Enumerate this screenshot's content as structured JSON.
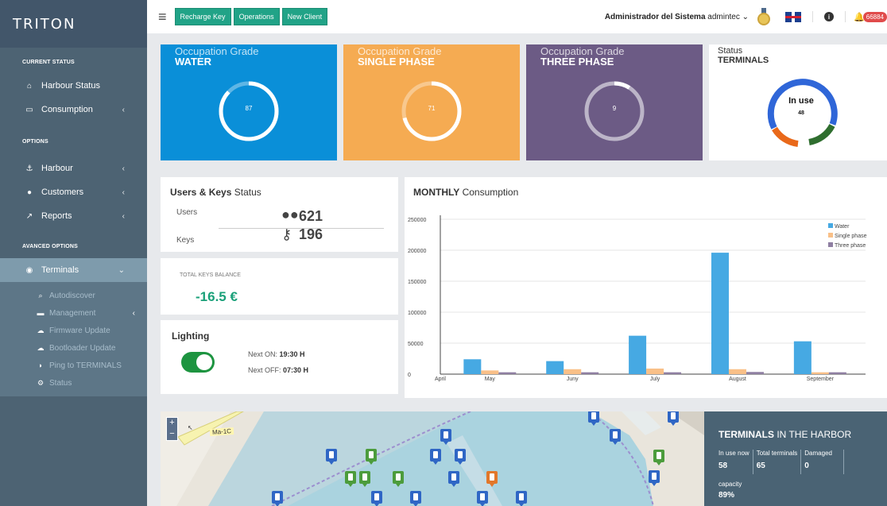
{
  "brand": "TRITON",
  "sidebar": {
    "sections": {
      "current": "CURRENT STATUS",
      "options": "OPTIONS",
      "advanced": "AVANCED OPTIONS"
    },
    "items": {
      "harbour_status": "Harbour Status",
      "consumption": "Consumption",
      "harbour": "Harbour",
      "customers": "Customers",
      "reports": "Reports",
      "terminals": "Terminals"
    },
    "submenu": {
      "autodiscover": "Autodiscover",
      "management": "Management",
      "firmware": "Firmware Update",
      "bootloader": "Bootloader Update",
      "ping": "Ping to TERMINALS",
      "status": "Status"
    }
  },
  "topbar": {
    "buttons": [
      "Recharge Key",
      "Operations",
      "New Client"
    ],
    "admin_name": "Administrador del Sistema",
    "admin_user": "admintec",
    "notifications": "66884"
  },
  "tiles": {
    "water": {
      "label": "Occupation Grade",
      "name": "WATER",
      "value": "87",
      "color": "#0a8fd8"
    },
    "single": {
      "label": "Occupation Grade",
      "name": "SINGLE PHASE",
      "value": "71",
      "color": "#f5ab52"
    },
    "three": {
      "label": "Occupation Grade",
      "name": "THREE PHASE",
      "value": "9",
      "color": "#6c5b85"
    }
  },
  "status_tile": {
    "label": "Status",
    "name": "TERMINALS",
    "center_label": "In use",
    "center_value": "48"
  },
  "users_keys": {
    "title_bold": "Users & Keys",
    "title_rest": " Status",
    "users_label": "Users",
    "users_value": "621",
    "keys_label": "Keys",
    "keys_value": "196"
  },
  "balance": {
    "label": "TOTAL KEYS BALANCE",
    "value": "-16.5 €"
  },
  "lighting": {
    "title": "Lighting",
    "next_on_label": "Next ON:",
    "next_on": "19:30 H",
    "next_off_label": "Next OFF:",
    "next_off": "07:30 H",
    "enabled": true
  },
  "monthly": {
    "title_bold": "MONTHLY",
    "title_rest": " Consumption"
  },
  "chart_data": {
    "type": "bar",
    "title": "MONTHLY Consumption",
    "categories": [
      "May",
      "Juny",
      "July",
      "August",
      "September"
    ],
    "x_start_label": "April",
    "series": [
      {
        "name": "Water",
        "color": "#46a9e3",
        "values": [
          24000,
          21000,
          62000,
          196000,
          53000
        ]
      },
      {
        "name": "Single phase",
        "color": "#f9c088",
        "values": [
          6000,
          8000,
          9000,
          8000,
          3000
        ]
      },
      {
        "name": "Three phase",
        "color": "#8f7fa2",
        "values": [
          3000,
          3000,
          3000,
          3500,
          3000
        ]
      }
    ],
    "ylim": [
      0,
      250000
    ],
    "yticks": [
      0,
      50000,
      100000,
      150000,
      200000,
      250000
    ],
    "grid": true,
    "legend": "top-right"
  },
  "map": {
    "road_label": "Ma-1C",
    "zoom_in": "+",
    "zoom_out": "−"
  },
  "harbor": {
    "title_bold": "TERMINALS",
    "title_rest": " IN THE HARBOR",
    "in_use_label": "In use now",
    "in_use": "58",
    "total_label": "Total terminals",
    "total": "65",
    "damaged_label": "Damaged",
    "damaged": "0",
    "capacity_label": "capacity",
    "capacity": "89%"
  }
}
